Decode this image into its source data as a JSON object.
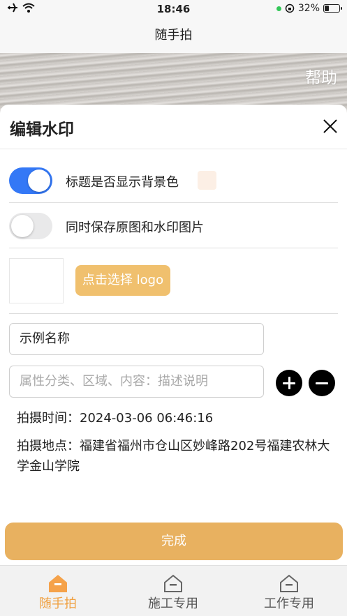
{
  "status": {
    "time": "18:46",
    "battery": "32%"
  },
  "nav": {
    "title": "随手拍"
  },
  "preview": {
    "help_label": "帮助"
  },
  "sheet": {
    "title": "编辑水印",
    "toggle_bg": {
      "label": "标题是否显示背景色",
      "on": true,
      "swatch_color": "#fcefe5"
    },
    "toggle_save": {
      "label": "同时保存原图和水印图片",
      "on": false
    },
    "logo_button": "点击选择 logo",
    "name_value": "示例名称",
    "attr_placeholder": "属性分类、区域、内容：描述说明",
    "time_label": "拍摄时间：",
    "time_value": "2024-03-06 06:46:16",
    "place_label": "拍摄地点：",
    "place_value": "福建省福州市仓山区妙峰路202号福建农林大学金山学院",
    "done_label": "完成"
  },
  "tabs": [
    {
      "label": "随手拍",
      "active": true
    },
    {
      "label": "施工专用",
      "active": false
    },
    {
      "label": "工作专用",
      "active": false
    }
  ],
  "colors": {
    "accent": "#3478f6",
    "orange": "#e8b160",
    "tab_active": "#f0a040"
  }
}
